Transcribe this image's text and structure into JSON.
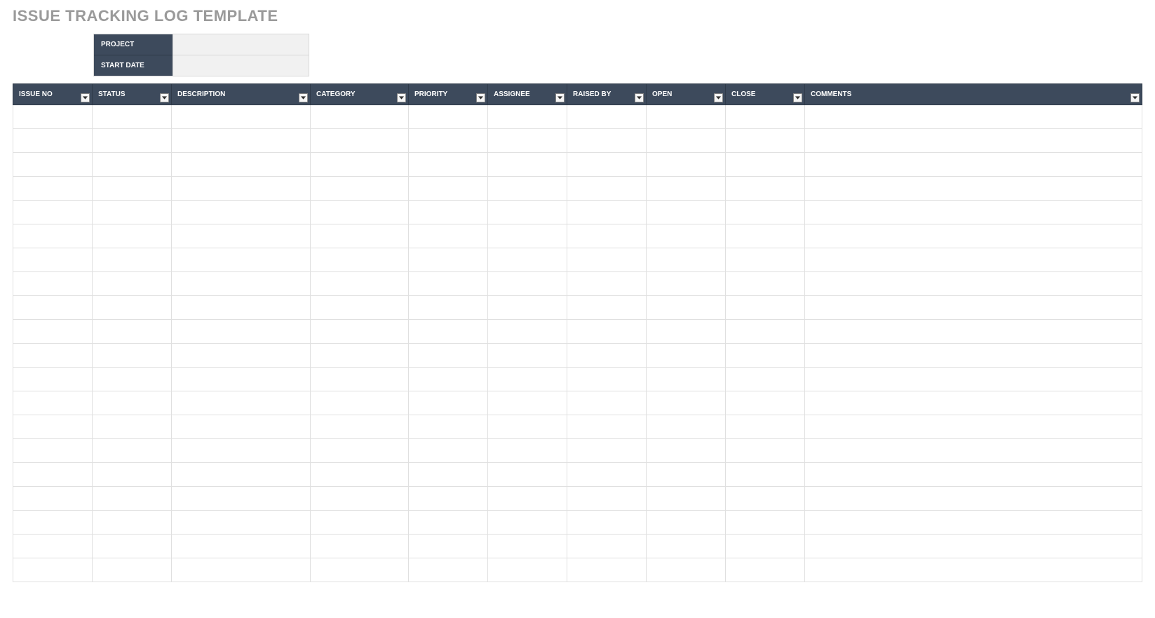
{
  "title": "ISSUE TRACKING LOG TEMPLATE",
  "meta": {
    "project_label": "PROJECT",
    "project_value": "",
    "start_date_label": "START DATE",
    "start_date_value": ""
  },
  "columns": [
    {
      "key": "issue_no",
      "label": "ISSUE NO"
    },
    {
      "key": "status",
      "label": "STATUS"
    },
    {
      "key": "description",
      "label": "DESCRIPTION"
    },
    {
      "key": "category",
      "label": "CATEGORY"
    },
    {
      "key": "priority",
      "label": "PRIORITY"
    },
    {
      "key": "assignee",
      "label": "ASSIGNEE"
    },
    {
      "key": "raised_by",
      "label": "RAISED BY"
    },
    {
      "key": "open",
      "label": "OPEN"
    },
    {
      "key": "close",
      "label": "CLOSE"
    },
    {
      "key": "comments",
      "label": "COMMENTS"
    }
  ],
  "rows": [
    {
      "issue_no": "",
      "status": "",
      "description": "",
      "category": "",
      "priority": "",
      "assignee": "",
      "raised_by": "",
      "open": "",
      "close": "",
      "comments": ""
    },
    {
      "issue_no": "",
      "status": "",
      "description": "",
      "category": "",
      "priority": "",
      "assignee": "",
      "raised_by": "",
      "open": "",
      "close": "",
      "comments": ""
    },
    {
      "issue_no": "",
      "status": "",
      "description": "",
      "category": "",
      "priority": "",
      "assignee": "",
      "raised_by": "",
      "open": "",
      "close": "",
      "comments": ""
    },
    {
      "issue_no": "",
      "status": "",
      "description": "",
      "category": "",
      "priority": "",
      "assignee": "",
      "raised_by": "",
      "open": "",
      "close": "",
      "comments": ""
    },
    {
      "issue_no": "",
      "status": "",
      "description": "",
      "category": "",
      "priority": "",
      "assignee": "",
      "raised_by": "",
      "open": "",
      "close": "",
      "comments": ""
    },
    {
      "issue_no": "",
      "status": "",
      "description": "",
      "category": "",
      "priority": "",
      "assignee": "",
      "raised_by": "",
      "open": "",
      "close": "",
      "comments": ""
    },
    {
      "issue_no": "",
      "status": "",
      "description": "",
      "category": "",
      "priority": "",
      "assignee": "",
      "raised_by": "",
      "open": "",
      "close": "",
      "comments": ""
    },
    {
      "issue_no": "",
      "status": "",
      "description": "",
      "category": "",
      "priority": "",
      "assignee": "",
      "raised_by": "",
      "open": "",
      "close": "",
      "comments": ""
    },
    {
      "issue_no": "",
      "status": "",
      "description": "",
      "category": "",
      "priority": "",
      "assignee": "",
      "raised_by": "",
      "open": "",
      "close": "",
      "comments": ""
    },
    {
      "issue_no": "",
      "status": "",
      "description": "",
      "category": "",
      "priority": "",
      "assignee": "",
      "raised_by": "",
      "open": "",
      "close": "",
      "comments": ""
    },
    {
      "issue_no": "",
      "status": "",
      "description": "",
      "category": "",
      "priority": "",
      "assignee": "",
      "raised_by": "",
      "open": "",
      "close": "",
      "comments": ""
    },
    {
      "issue_no": "",
      "status": "",
      "description": "",
      "category": "",
      "priority": "",
      "assignee": "",
      "raised_by": "",
      "open": "",
      "close": "",
      "comments": ""
    },
    {
      "issue_no": "",
      "status": "",
      "description": "",
      "category": "",
      "priority": "",
      "assignee": "",
      "raised_by": "",
      "open": "",
      "close": "",
      "comments": ""
    },
    {
      "issue_no": "",
      "status": "",
      "description": "",
      "category": "",
      "priority": "",
      "assignee": "",
      "raised_by": "",
      "open": "",
      "close": "",
      "comments": ""
    },
    {
      "issue_no": "",
      "status": "",
      "description": "",
      "category": "",
      "priority": "",
      "assignee": "",
      "raised_by": "",
      "open": "",
      "close": "",
      "comments": ""
    },
    {
      "issue_no": "",
      "status": "",
      "description": "",
      "category": "",
      "priority": "",
      "assignee": "",
      "raised_by": "",
      "open": "",
      "close": "",
      "comments": ""
    },
    {
      "issue_no": "",
      "status": "",
      "description": "",
      "category": "",
      "priority": "",
      "assignee": "",
      "raised_by": "",
      "open": "",
      "close": "",
      "comments": ""
    },
    {
      "issue_no": "",
      "status": "",
      "description": "",
      "category": "",
      "priority": "",
      "assignee": "",
      "raised_by": "",
      "open": "",
      "close": "",
      "comments": ""
    },
    {
      "issue_no": "",
      "status": "",
      "description": "",
      "category": "",
      "priority": "",
      "assignee": "",
      "raised_by": "",
      "open": "",
      "close": "",
      "comments": ""
    },
    {
      "issue_no": "",
      "status": "",
      "description": "",
      "category": "",
      "priority": "",
      "assignee": "",
      "raised_by": "",
      "open": "",
      "close": "",
      "comments": ""
    }
  ]
}
